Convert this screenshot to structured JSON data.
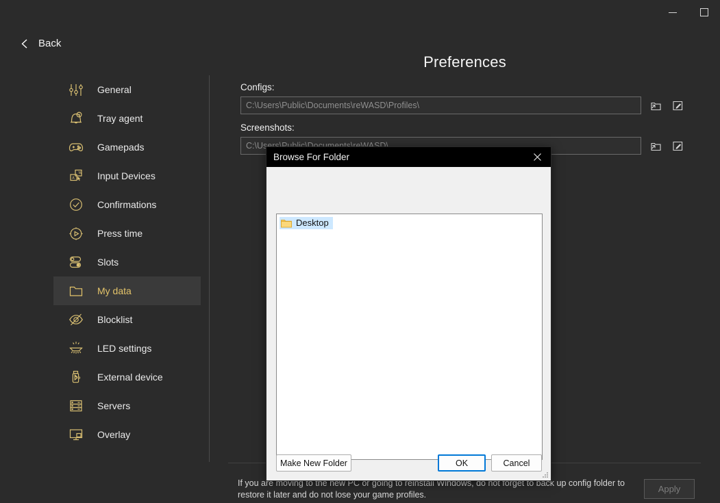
{
  "window": {
    "minimize_label": "Minimize",
    "maximize_label": "Maximize"
  },
  "header": {
    "back_label": "Back",
    "title": "Preferences"
  },
  "sidebar": {
    "items": [
      {
        "label": "General",
        "icon": "sliders-icon",
        "selected": false
      },
      {
        "label": "Tray agent",
        "icon": "bell-bolt-icon",
        "selected": false
      },
      {
        "label": "Gamepads",
        "icon": "gamepad-icon",
        "selected": false
      },
      {
        "label": "Input Devices",
        "icon": "keyboard-mouse-icon",
        "selected": false
      },
      {
        "label": "Confirmations",
        "icon": "check-circle-icon",
        "selected": false
      },
      {
        "label": "Press time",
        "icon": "stopwatch-play-icon",
        "selected": false
      },
      {
        "label": "Slots",
        "icon": "toggles-icon",
        "selected": false
      },
      {
        "label": "My data",
        "icon": "folder-icon",
        "selected": true
      },
      {
        "label": "Blocklist",
        "icon": "eye-slash-icon",
        "selected": false
      },
      {
        "label": "LED settings",
        "icon": "led-light-icon",
        "selected": false
      },
      {
        "label": "External device",
        "icon": "usb-bluetooth-icon",
        "selected": false
      },
      {
        "label": "Servers",
        "icon": "servers-icon",
        "selected": false
      },
      {
        "label": "Overlay",
        "icon": "monitor-overlay-icon",
        "selected": false
      }
    ]
  },
  "main": {
    "fields": [
      {
        "label": "Configs:",
        "value": "C:\\Users\\Public\\Documents\\reWASD\\Profiles\\",
        "placeholder": "C:\\Users\\Public\\Documents\\reWASD\\Profiles\\",
        "browse_icon": "open-folder-icon",
        "edit_icon": "edit-square-icon"
      },
      {
        "label": "Screenshots:",
        "value": "C:\\Users\\Public\\Documents\\reWASD\\",
        "placeholder": "C:\\Users\\Public\\Documents\\reWASD\\",
        "browse_icon": "open-folder-icon",
        "edit_icon": "edit-square-icon"
      }
    ],
    "footer_note": "If you are moving to the new PC or going to reinstall Windows, do not forget to back up config folder to restore it later and do not lose your game profiles.",
    "apply_label": "Apply"
  },
  "dialog": {
    "title": "Browse For Folder",
    "close_icon": "close-icon",
    "tree": [
      {
        "label": "Desktop",
        "icon": "folder-icon",
        "selected": true
      }
    ],
    "buttons": {
      "new_folder": "Make New Folder",
      "ok": "OK",
      "cancel": "Cancel"
    }
  },
  "colors": {
    "accent": "#e3c36a",
    "background": "#2b2b2b",
    "selected_nav": "#3a3a3a",
    "dialog_body": "#f0f0f0",
    "dialog_titlebar": "#000000",
    "tree_selection": "#cde8ff",
    "focus_border": "#0078d7",
    "folder_yellow": "#f2c14b"
  }
}
